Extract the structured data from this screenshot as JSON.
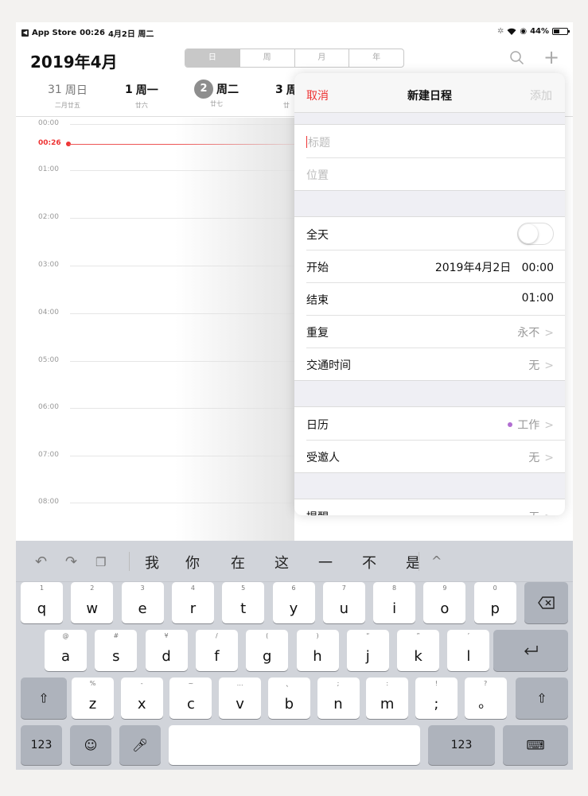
{
  "status_bar": {
    "back_app": "App Store",
    "time": "00:26",
    "date": "4月2日 周二",
    "battery": "44%",
    "battery_level": 0.44
  },
  "header": {
    "month_title": "2019年4月",
    "segments": [
      "日",
      "周",
      "月",
      "年"
    ]
  },
  "days": [
    {
      "num": "31",
      "weekday": "周日",
      "lunar": "二月廿五"
    },
    {
      "num": "1",
      "weekday": "周一",
      "lunar": "廿六"
    },
    {
      "num": "2",
      "weekday": "周二",
      "lunar": "廿七"
    },
    {
      "num": "3",
      "weekday": "周",
      "lunar": "廿"
    }
  ],
  "timeline": {
    "hours": [
      "00:00",
      "01:00",
      "02:00",
      "03:00",
      "04:00",
      "05:00",
      "06:00",
      "07:00",
      "08:00"
    ],
    "now": "00:26"
  },
  "popover": {
    "cancel": "取消",
    "title": "新建日程",
    "add": "添加",
    "title_placeholder": "标题",
    "location_placeholder": "位置",
    "all_day": "全天",
    "start_label": "开始",
    "start_date": "2019年4月2日",
    "start_time": "00:00",
    "end_label": "结束",
    "end_time": "01:00",
    "repeat_label": "重复",
    "repeat_value": "永不",
    "travel_label": "交通时间",
    "travel_value": "无",
    "calendar_label": "日历",
    "calendar_value": "工作",
    "calendar_color": "#b16ed1",
    "invitees_label": "受邀人",
    "invitees_value": "无",
    "alert_label": "提醒",
    "alert_value": "无"
  },
  "keyboard": {
    "candidates": [
      "我",
      "你",
      "在",
      "这",
      "一",
      "不",
      "是"
    ],
    "row1": [
      {
        "hint": "1",
        "ch": "q"
      },
      {
        "hint": "2",
        "ch": "w"
      },
      {
        "hint": "3",
        "ch": "e"
      },
      {
        "hint": "4",
        "ch": "r"
      },
      {
        "hint": "5",
        "ch": "t"
      },
      {
        "hint": "6",
        "ch": "y"
      },
      {
        "hint": "7",
        "ch": "u"
      },
      {
        "hint": "8",
        "ch": "i"
      },
      {
        "hint": "9",
        "ch": "o"
      },
      {
        "hint": "0",
        "ch": "p"
      }
    ],
    "row2": [
      {
        "hint": "@",
        "ch": "a"
      },
      {
        "hint": "#",
        "ch": "s"
      },
      {
        "hint": "¥",
        "ch": "d"
      },
      {
        "hint": "/",
        "ch": "f"
      },
      {
        "hint": "(",
        "ch": "g"
      },
      {
        "hint": ")",
        "ch": "h"
      },
      {
        "hint": "“",
        "ch": "j"
      },
      {
        "hint": "”",
        "ch": "k"
      },
      {
        "hint": "’",
        "ch": "l"
      }
    ],
    "row3": [
      {
        "hint": "%",
        "ch": "z"
      },
      {
        "hint": "-",
        "ch": "x"
      },
      {
        "hint": "~",
        "ch": "c"
      },
      {
        "hint": "…",
        "ch": "v"
      },
      {
        "hint": "、",
        "ch": "b"
      },
      {
        "hint": ";",
        "ch": "n"
      },
      {
        "hint": ":",
        "ch": "m"
      },
      {
        "hint": "!",
        "ch": ";"
      },
      {
        "hint": "?",
        "ch": "。"
      }
    ],
    "num_key": "123"
  }
}
